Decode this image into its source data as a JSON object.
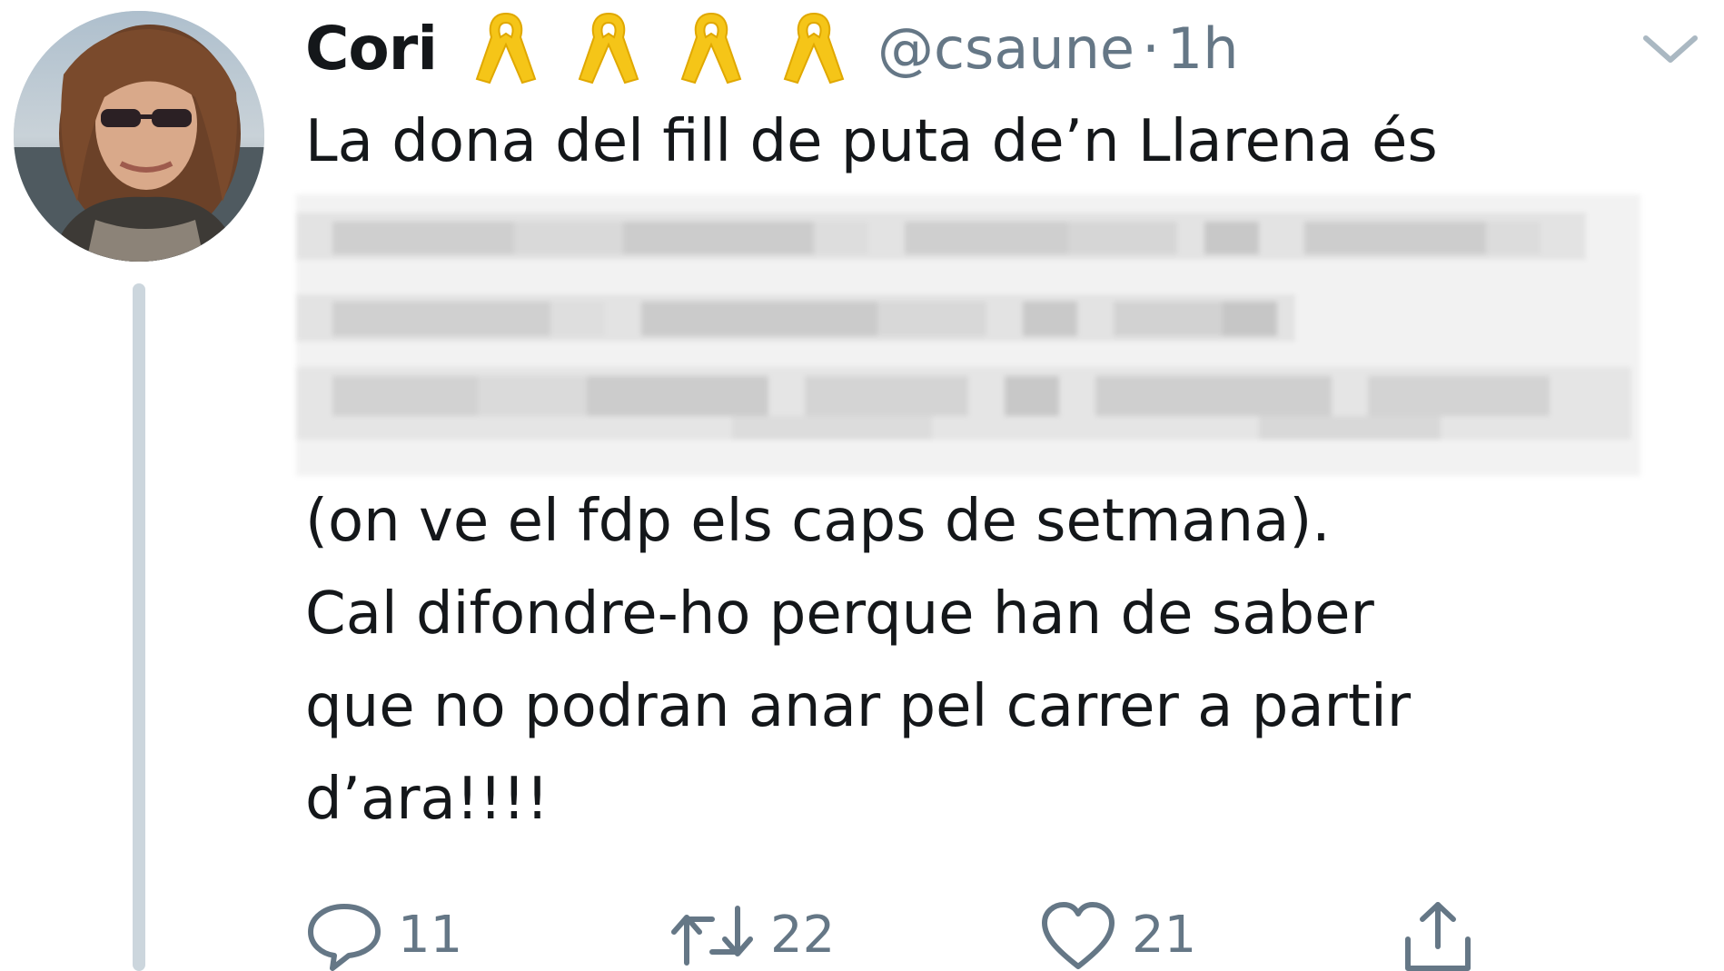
{
  "tweet": {
    "display_name": "Cori",
    "badge_icons": [
      "yellow-ribbon-icon",
      "yellow-ribbon-icon",
      "yellow-ribbon-icon",
      "yellow-ribbon-icon"
    ],
    "handle": "@csaune",
    "separator": "·",
    "time": "1h",
    "text_lines": [
      "La dona del fill de puta de’n Llarena és",
      "(on ve el fdp els caps de setmana).",
      "Cal difondre-ho perque han de saber",
      "que no podran anar pel carrer a partir",
      "d’ara!!!!"
    ]
  },
  "actions": {
    "reply": {
      "icon": "reply-icon",
      "count": "11"
    },
    "retweet": {
      "icon": "retweet-icon",
      "count": "22"
    },
    "like": {
      "icon": "heart-icon",
      "count": "21"
    },
    "share": {
      "icon": "share-icon"
    }
  },
  "colors": {
    "text": "#14171a",
    "secondary": "#657786",
    "ribbon": "#f5c518",
    "thread_line": "#ccd6dd"
  }
}
